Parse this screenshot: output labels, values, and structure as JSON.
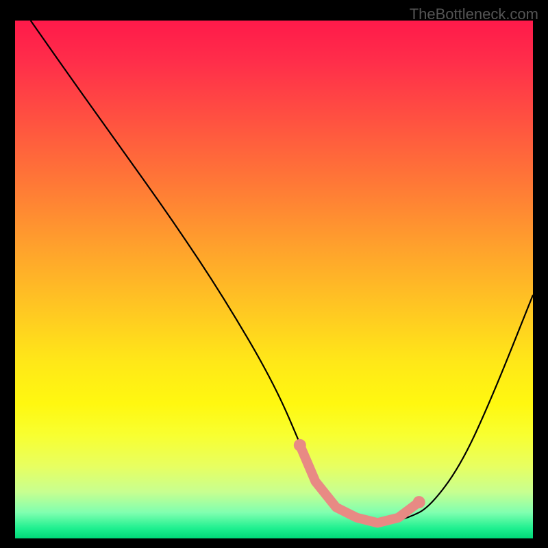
{
  "watermark": "TheBottleneck.com",
  "chart_data": {
    "type": "line",
    "title": "",
    "xlabel": "",
    "ylabel": "",
    "xlim": [
      0,
      100
    ],
    "ylim": [
      0,
      100
    ],
    "series": [
      {
        "name": "bottleneck-curve",
        "x": [
          3,
          10,
          20,
          30,
          40,
          50,
          56,
          58,
          60,
          64,
          68,
          72,
          76,
          80,
          86,
          92,
          100
        ],
        "values": [
          100,
          90,
          76,
          62,
          47,
          30,
          16,
          11,
          7,
          4,
          3,
          3,
          4,
          6,
          14,
          27,
          47
        ]
      }
    ],
    "highlight": {
      "name": "optimal-zone",
      "x": [
        55,
        58,
        62,
        66,
        70,
        74,
        78
      ],
      "values": [
        18,
        11,
        6,
        4,
        3,
        4,
        7
      ],
      "color": "#e88a84"
    },
    "gradient": {
      "top_color": "#ff1a4a",
      "mid_color": "#ffe818",
      "bottom_color": "#00d878"
    }
  }
}
